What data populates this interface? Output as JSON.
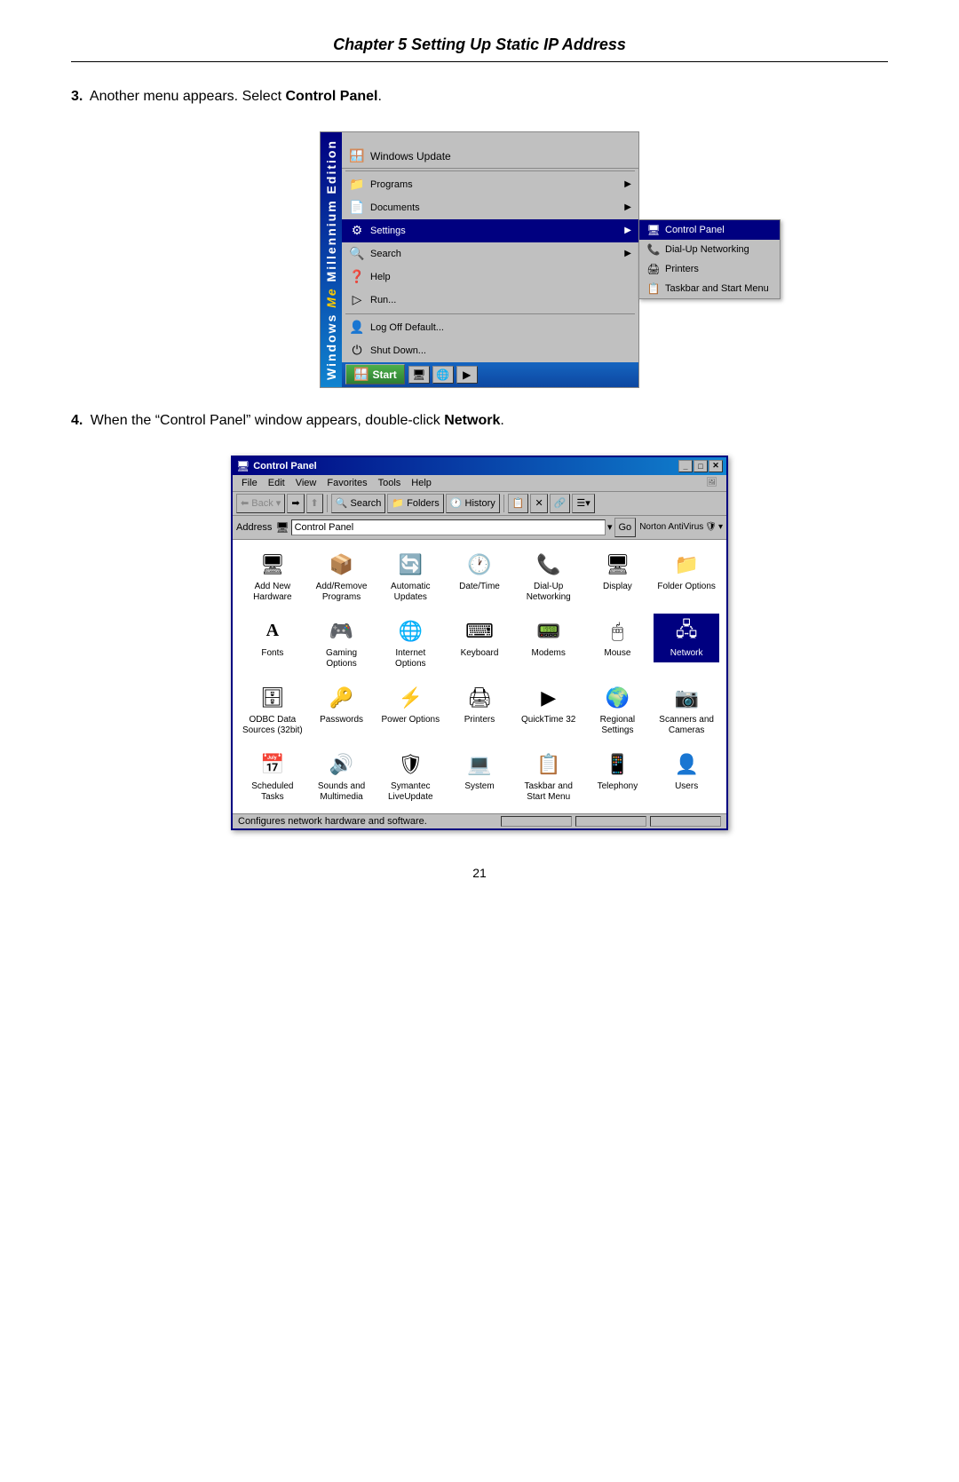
{
  "chapter": {
    "title": "Chapter 5  Setting Up Static IP Address"
  },
  "step3": {
    "number": "3.",
    "text": "Another menu appears. Select ",
    "bold": "Control Panel",
    "period": "."
  },
  "step4": {
    "number": "4.",
    "text": "When the “Control Panel” window appears, double-click ",
    "bold": "Network",
    "period": "."
  },
  "startmenu": {
    "sidebar_text": "Windows Me Millennium Edition",
    "windows_update": "Windows Update",
    "items": [
      {
        "label": "Programs",
        "arrow": true
      },
      {
        "label": "Documents",
        "arrow": true
      },
      {
        "label": "Settings",
        "arrow": true,
        "selected": true
      },
      {
        "label": "Search",
        "arrow": true
      },
      {
        "label": "Help"
      },
      {
        "label": "Run..."
      },
      {
        "label": "Log Off Default...",
        "divider_before": true
      },
      {
        "label": "Shut Down..."
      }
    ],
    "submenu": {
      "items": [
        {
          "label": "Control Panel",
          "highlighted": true
        },
        {
          "label": "Dial-Up Networking"
        },
        {
          "label": "Printers"
        },
        {
          "label": "Taskbar and Start Menu"
        }
      ]
    },
    "taskbar": {
      "start_label": "Start"
    }
  },
  "controlpanel": {
    "title": "Control Panel",
    "menu": [
      "File",
      "Edit",
      "View",
      "Favorites",
      "Tools",
      "Help"
    ],
    "toolbar": {
      "back": "Back",
      "forward": "Forward",
      "up": "",
      "search": "Search",
      "folders": "Folders",
      "history": "History"
    },
    "addressbar": {
      "label": "Address",
      "value": "Control Panel",
      "go": "Go",
      "norton": "Norton AntiVirus"
    },
    "items": [
      {
        "label": "Add New\nHardware",
        "icon": "🖥"
      },
      {
        "label": "Add/Remove\nPrograms",
        "icon": "📦"
      },
      {
        "label": "Automatic\nUpdates",
        "icon": "🔄"
      },
      {
        "label": "Date/Time",
        "icon": "🕐"
      },
      {
        "label": "Dial-Up\nNetworking",
        "icon": "📞"
      },
      {
        "label": "Display",
        "icon": "🖥"
      },
      {
        "label": "Folder Options",
        "icon": "📁"
      },
      {
        "label": "Fonts",
        "icon": "A"
      },
      {
        "label": "Gaming\nOptions",
        "icon": "🎮"
      },
      {
        "label": "Internet\nOptions",
        "icon": "🌐"
      },
      {
        "label": "Keyboard",
        "icon": "⌨"
      },
      {
        "label": "Modems",
        "icon": "📟"
      },
      {
        "label": "Mouse",
        "icon": "🖱"
      },
      {
        "label": "Network",
        "icon": "🖧",
        "selected": true
      },
      {
        "label": "ODBC Data\nSources (32bit)",
        "icon": "🗄"
      },
      {
        "label": "Passwords",
        "icon": "🔑"
      },
      {
        "label": "Power Options",
        "icon": "⚡"
      },
      {
        "label": "Printers",
        "icon": "🖨"
      },
      {
        "label": "QuickTime 32",
        "icon": "▶"
      },
      {
        "label": "Regional\nSettings",
        "icon": "🌍"
      },
      {
        "label": "Scanners and\nCameras",
        "icon": "📷"
      },
      {
        "label": "Scheduled\nTasks",
        "icon": "📅"
      },
      {
        "label": "Sounds and\nMultimedia",
        "icon": "🔊"
      },
      {
        "label": "Symantec\nLiveUpdate",
        "icon": "🛡"
      },
      {
        "label": "System",
        "icon": "💻"
      },
      {
        "label": "Taskbar and\nStart Menu",
        "icon": "📋"
      },
      {
        "label": "Telephony",
        "icon": "📱"
      },
      {
        "label": "Users",
        "icon": "👤"
      }
    ],
    "statusbar": "Configures network hardware and software."
  },
  "page_number": "21"
}
